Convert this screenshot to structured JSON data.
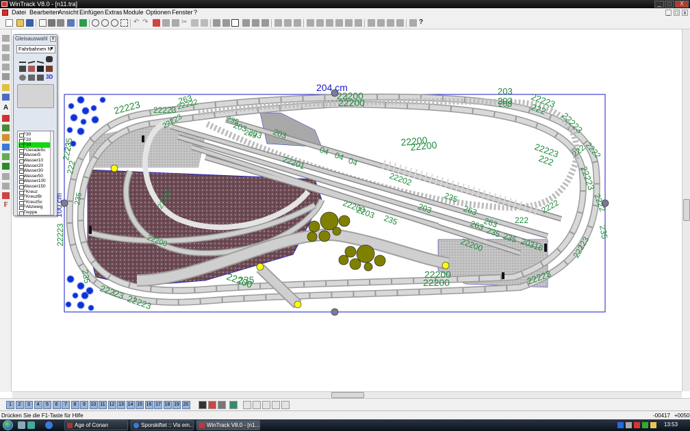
{
  "window": {
    "title": "WinTrack  V8.0 - [n11.tra]",
    "controls": {
      "minimize": "_",
      "maximize": "□",
      "close": "X"
    }
  },
  "menu": {
    "items": [
      "Datei",
      "Bearbeiten",
      "Ansicht",
      "Einfügen",
      "Extras",
      "Module",
      "Optionen",
      "Fenster",
      "?"
    ],
    "mdi_controls": {
      "minimize": "_",
      "restore": "□",
      "close": "x"
    }
  },
  "left_tools": {
    "text_tool": "A",
    "font_tool": "F"
  },
  "palette": {
    "title": "Gleisauswahl",
    "close": "x",
    "selector_value": "Fahrbahnen N",
    "badge_3d": "3D",
    "list": [
      "F30",
      "F20",
      "F10",
      "FGerade5c",
      "Wasser5",
      "Wasser10",
      "Wasser20",
      "Wasser30",
      "Wasser50",
      "Wasser100",
      "Wasser150",
      "FKreuz",
      "FKreuzBr",
      "FKreuz5c",
      "FAbzweig",
      "Treppe"
    ],
    "selected": "F10"
  },
  "layout": {
    "dimension": "204 cm",
    "side_dimension": "100 cm",
    "labels": [
      "22223",
      "22200",
      "22200",
      "203",
      "203",
      "22223",
      "222",
      "22223",
      "263",
      "22222",
      "22223",
      "22200",
      "203",
      "222",
      "22223",
      "22223",
      "222",
      "2222",
      "2222",
      "235",
      "22223",
      "203",
      "203",
      "203",
      "04",
      "04",
      "04",
      "22201",
      "22202",
      "22200",
      "235",
      "263",
      "235",
      "203",
      "263",
      "222",
      "20316",
      "22200",
      "22200",
      "22200",
      "235",
      "22223",
      "222",
      "2222",
      "2223",
      "235",
      "22223",
      "235",
      "22223",
      "235",
      "22223",
      "263",
      "235",
      "235",
      "2203",
      "22200",
      "22223",
      "235",
      "22200",
      "22200",
      "22200",
      "203"
    ],
    "colors": {
      "label": "#1f8a3c",
      "frame": "#1a1ac8",
      "track_fill": "#c8c8c8",
      "terrain": "#6d4c55",
      "gravel": "#b9b9b9",
      "tree": "#808000",
      "flower": "#1030d8"
    }
  },
  "pagebar": {
    "pages": [
      "1",
      "2",
      "3",
      "4",
      "5",
      "6",
      "7",
      "8",
      "9",
      "10",
      "11",
      "12",
      "13",
      "14",
      "15",
      "16",
      "17",
      "18",
      "19",
      "20"
    ]
  },
  "status": {
    "hint": "Drücken Sie die  F1-Taste für Hilfe",
    "x": "-00417",
    "y": "+00509"
  },
  "taskbar": {
    "tasks": [
      "Age of Conan",
      "Sporskiftet :: Vis em...",
      "WinTrack  V8.0 - [n1..."
    ],
    "clock": "13:53"
  }
}
